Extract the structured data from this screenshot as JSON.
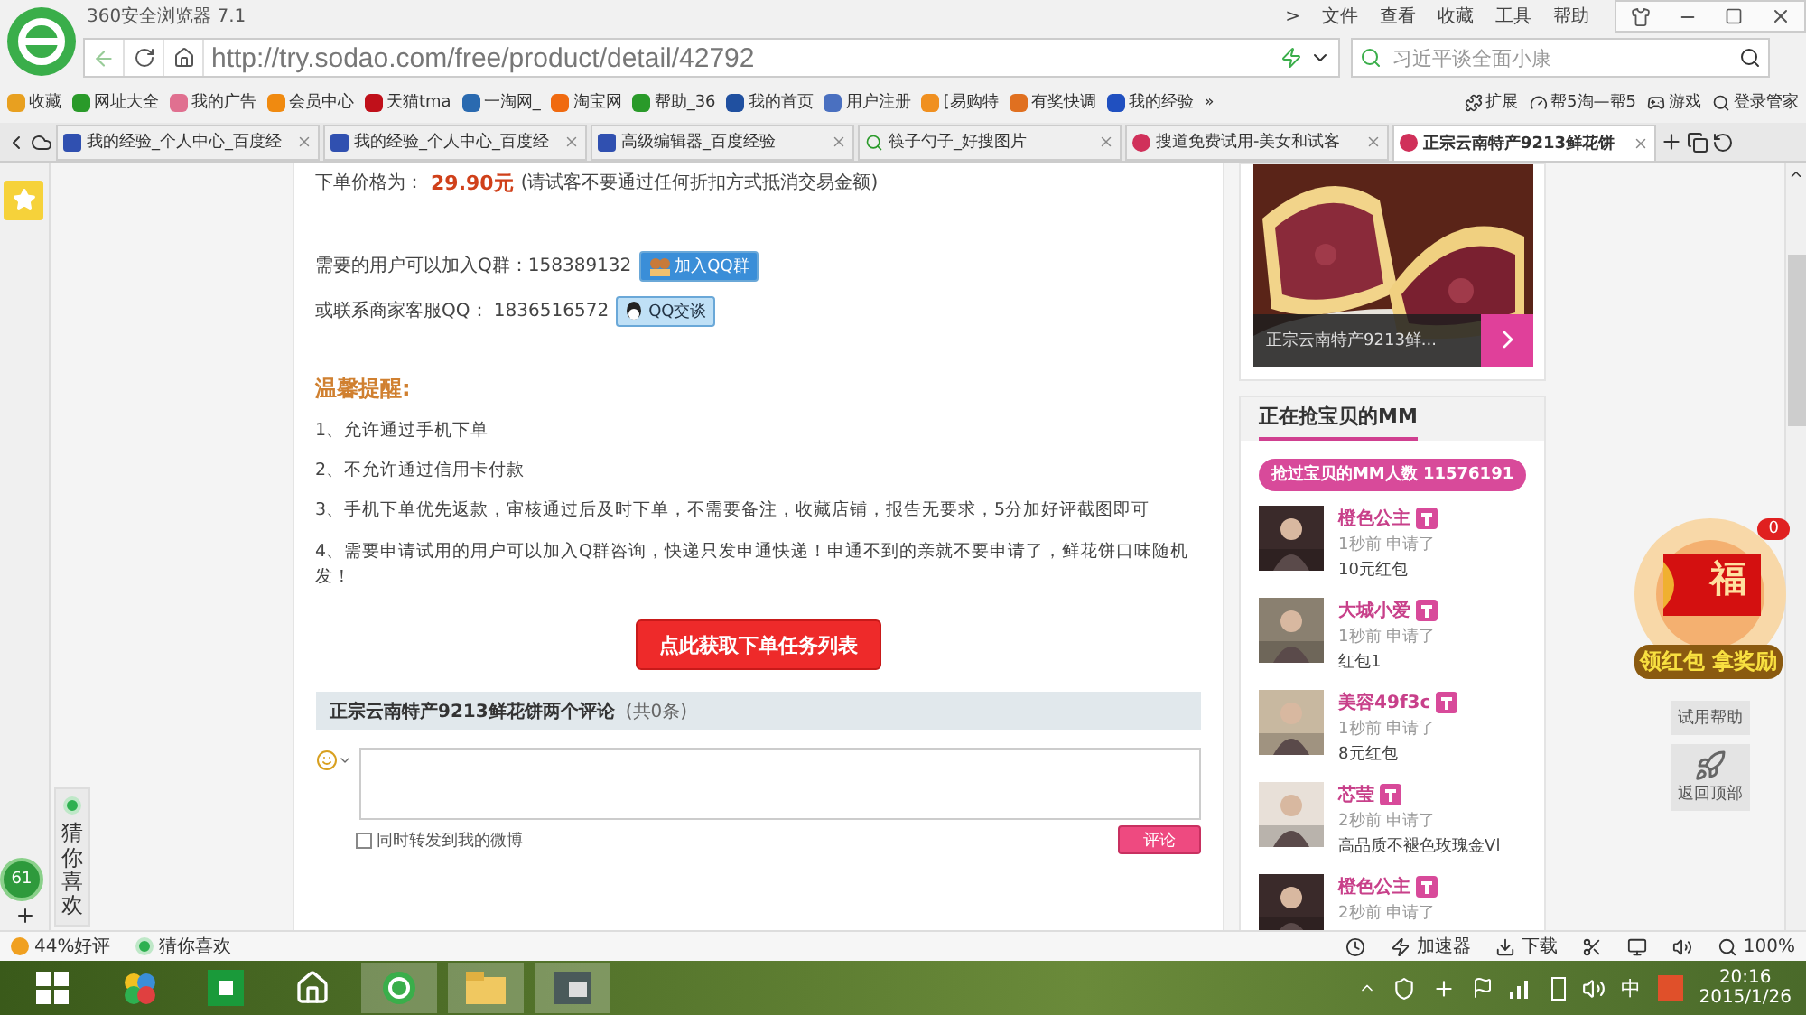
{
  "browser": {
    "title": "360安全浏览器 7.1",
    "menu": [
      ">",
      "文件",
      "查看",
      "收藏",
      "工具",
      "帮助"
    ],
    "url": "http://try.sodao.com/free/product/detail/42792",
    "search": {
      "placeholder": "习近平谈全面小康"
    }
  },
  "bookmarks": [
    {
      "label": "收藏",
      "color": "#e8a020"
    },
    {
      "label": "网址大全",
      "color": "#2a9a2a"
    },
    {
      "label": "我的广告",
      "color": "#e07090"
    },
    {
      "label": "会员中心",
      "color": "#f08a10"
    },
    {
      "label": "天猫tma",
      "color": "#c0101a"
    },
    {
      "label": "一淘网_",
      "color": "#2a6ab0"
    },
    {
      "label": "淘宝网",
      "color": "#f06a10"
    },
    {
      "label": "帮助_36",
      "color": "#2a9a2a"
    },
    {
      "label": "我的首页",
      "color": "#2050a0"
    },
    {
      "label": "用户注册",
      "color": "#4a70c0"
    },
    {
      "label": "[易购特",
      "color": "#f09020"
    },
    {
      "label": "有奖快调",
      "color": "#e07020"
    },
    {
      "label": "我的经验",
      "color": "#2050c0"
    }
  ],
  "bookmark_more": "»",
  "bookmarks_right": [
    {
      "label": "扩展"
    },
    {
      "label": "帮5淘—帮5"
    },
    {
      "label": "游戏"
    },
    {
      "label": "登录管家"
    }
  ],
  "tabs": [
    {
      "label": "我的经验_个人中心_百度经",
      "selected": false,
      "kind": "paw"
    },
    {
      "label": "我的经验_个人中心_百度经",
      "selected": false,
      "kind": "paw"
    },
    {
      "label": "高级编辑器_百度经验",
      "selected": false,
      "kind": "paw"
    },
    {
      "label": "筷子勺子_好搜图片",
      "selected": false,
      "kind": "search"
    },
    {
      "label": "搜道免费试用-美女和试客",
      "selected": false,
      "kind": "sodao"
    },
    {
      "label": "正宗云南特产9213鲜花饼",
      "selected": true,
      "kind": "sodao"
    }
  ],
  "product": {
    "price_label": "下单价格为：",
    "price": "29.90元",
    "price_note": "(请试客不要通过任何折扣方式抵消交易金额)",
    "group_text": "需要的用户可以加入Q群：158389132",
    "group_button": "加入QQ群",
    "service_text": "或联系商家客服QQ： 1836516572",
    "service_button": "QQ交谈",
    "tips_title": "温馨提醒:",
    "tips": [
      "1、允许通过手机下单",
      "2、不允许通过信用卡付款",
      "3、手机下单优先返款，审核通过后及时下单，不需要备注，收藏店铺，报告无要求，5分加好评截图即可",
      "4、需要申请试用的用户可以加入Q群咨询，快递只发申通快递！申通不到的亲就不要申请了，鲜花饼口味随机发！"
    ],
    "cta": "点此获取下单任务列表"
  },
  "comments": {
    "title": "正宗云南特产9213鲜花饼两个评论",
    "count": "(共0条)",
    "share": {
      "label": "同时转发到我的微博",
      "checked": false
    },
    "submit": "评论"
  },
  "sidebar": {
    "caption": "正宗云南特产9213鲜...",
    "section_title": "正在抢宝贝的MM",
    "total": "抢过宝贝的MM人数 11576191",
    "applicants": [
      {
        "name": "橙色公主",
        "time": "1秒前 申请了",
        "prize": "10元红包"
      },
      {
        "name": "大城小爱",
        "time": "1秒前 申请了",
        "prize": "红包1"
      },
      {
        "name": "美容49f3c",
        "time": "1秒前 申请了",
        "prize": "8元红包"
      },
      {
        "name": "芯莹",
        "time": "2秒前 申请了",
        "prize": "高品质不褪色玫瑰金Vl"
      },
      {
        "name": "橙色公主",
        "time": "2秒前 申请了"
      }
    ]
  },
  "float": {
    "badge": "0",
    "envelope_char": "福",
    "banner": "领红包 拿奖励",
    "help": "试用帮助",
    "top": "返回顶部"
  },
  "left": {
    "bubble": "61",
    "guess": "猜你喜欢"
  },
  "status": {
    "rating": "44%好评",
    "guess": "猜你喜欢",
    "accelerator": "加速器",
    "download": "下载",
    "zoom": "100%"
  },
  "taskbar": {
    "ime": "中",
    "time": "20:16",
    "date": "2015/1/26"
  }
}
